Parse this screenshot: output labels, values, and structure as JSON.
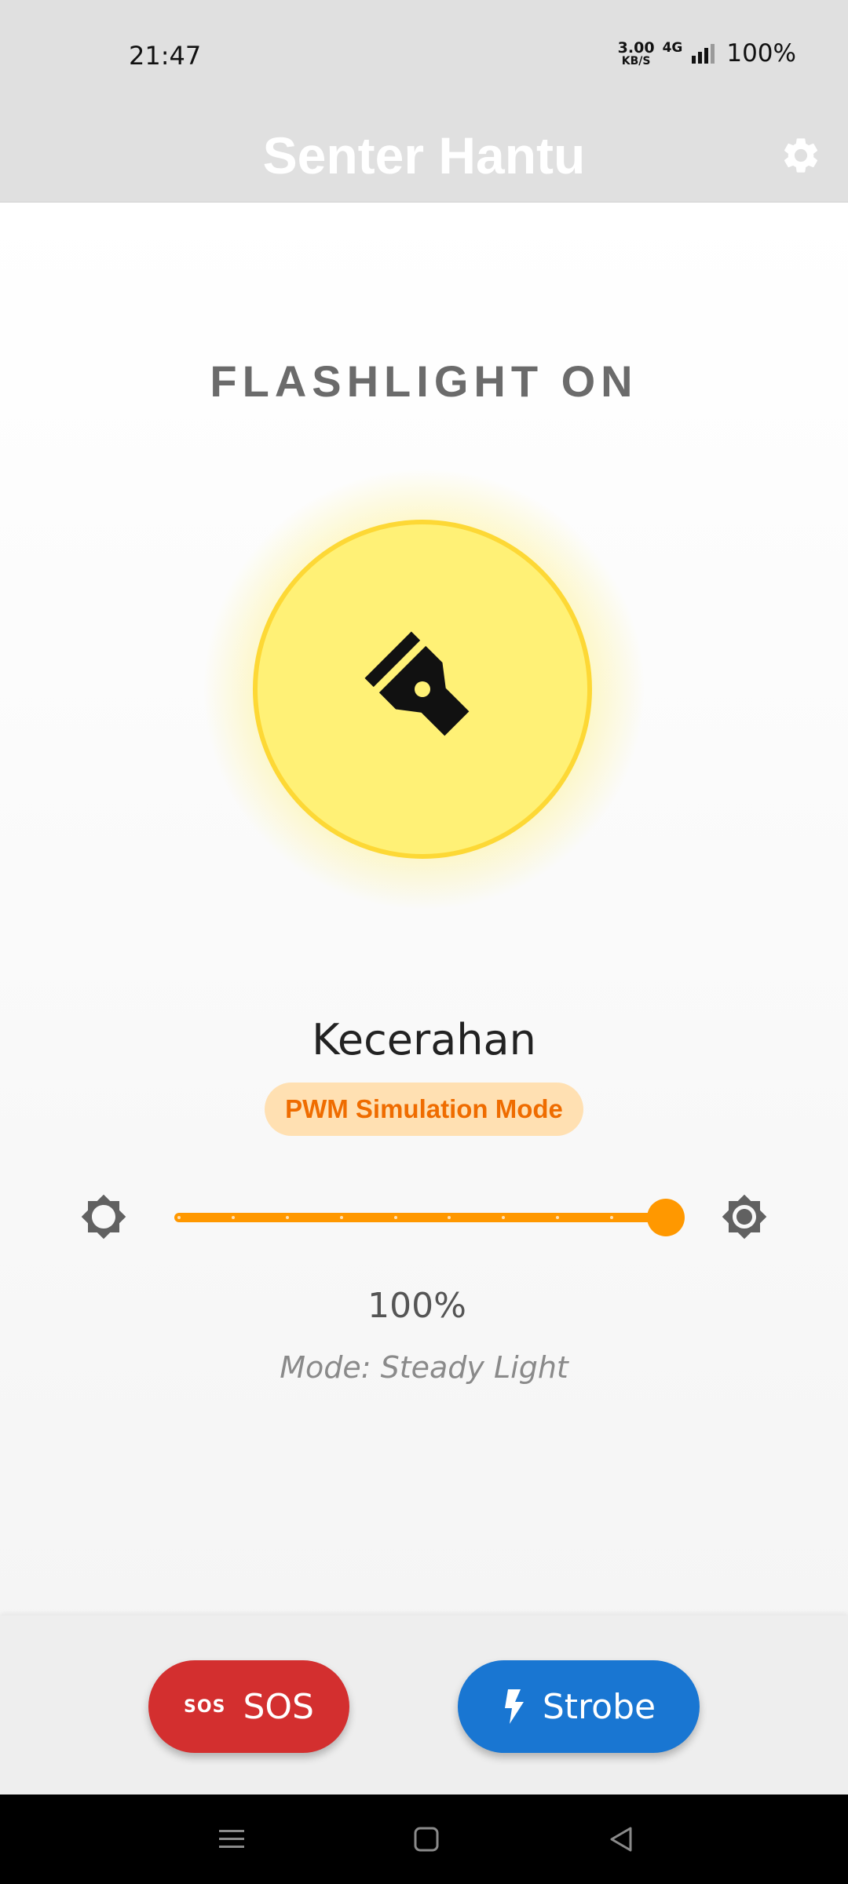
{
  "status_bar": {
    "time": "21:47",
    "net_speed_value": "3.00",
    "net_speed_unit": "KB/S",
    "network_type": "4G",
    "battery": "100%",
    "icons": [
      "network-speed-indicator",
      "signal-icon"
    ]
  },
  "app_bar": {
    "title": "Senter Hantu",
    "settings_icon": "gear-icon"
  },
  "flashlight": {
    "status_text": "FLASHLIGHT ON",
    "icon": "flashlight-icon",
    "button_color": "#fff176",
    "ring_color": "#fdd835"
  },
  "brightness": {
    "title": "Kecerahan",
    "badge": "PWM Simulation Mode",
    "low_icon": "brightness-low-icon",
    "high_icon": "brightness-high-icon",
    "level_fraction": 1.0,
    "divisions": 9,
    "percent_text": "100%",
    "mode_text": "Mode: Steady Light",
    "accent_color": "#ff9800"
  },
  "actions": {
    "sos": {
      "icon_text": "SOS",
      "label": "SOS",
      "color": "#d32f2f"
    },
    "strobe": {
      "icon": "bolt-icon",
      "label": "Strobe",
      "color": "#1976d2"
    }
  },
  "nav_bar": {
    "icons": [
      "menu-icon",
      "home-icon",
      "back-icon"
    ]
  }
}
